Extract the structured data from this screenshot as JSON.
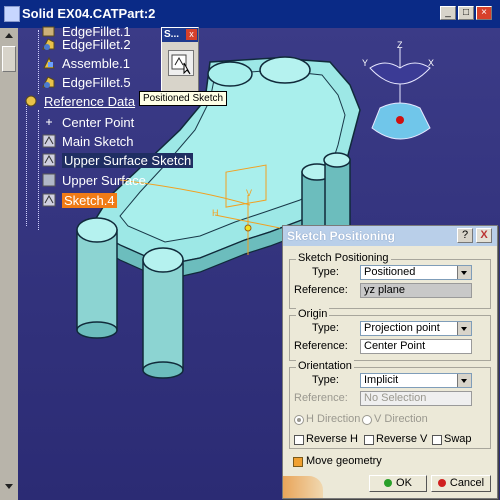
{
  "window": {
    "title": "Solid EX04.CATPart:2"
  },
  "tree": {
    "items": [
      {
        "label": "EdgeFillet.1",
        "icon": "edge-fillet-icon"
      },
      {
        "label": "EdgeFillet.2",
        "icon": "edge-fillet-icon"
      },
      {
        "label": "Assemble.1",
        "icon": "assemble-icon"
      },
      {
        "label": "EdgeFillet.5",
        "icon": "edge-fillet-icon"
      },
      {
        "label": "Reference Data",
        "icon": "reference-icon"
      },
      {
        "label": "Center Point",
        "icon": "point-icon"
      },
      {
        "label": "Main Sketch",
        "icon": "sketch-icon"
      },
      {
        "label": "Upper Surface Sketch",
        "icon": "sketch-icon"
      },
      {
        "label": "Upper Surface",
        "icon": "surface-icon"
      },
      {
        "label": "Sketch.4",
        "icon": "sketch-icon"
      }
    ]
  },
  "mini_toolbar": {
    "title": "S...",
    "close": "x"
  },
  "tooltip": "Positioned Sketch",
  "dialog": {
    "title": "Sketch Positioning",
    "help": "?",
    "close": "X",
    "sketch_positioning": {
      "group": "Sketch Positioning",
      "type_label": "Type:",
      "type_value": "Positioned",
      "reference_label": "Reference:",
      "reference_value": "yz plane"
    },
    "origin": {
      "group": "Origin",
      "type_label": "Type:",
      "type_value": "Projection point",
      "reference_label": "Reference:",
      "reference_value": "Center Point"
    },
    "orientation": {
      "group": "Orientation",
      "type_label": "Type:",
      "type_value": "Implicit",
      "reference_label": "Reference:",
      "reference_value": "No Selection",
      "h_direction": "H Direction",
      "v_direction": "V Direction",
      "reverse_h": "Reverse H",
      "reverse_v": "Reverse V",
      "swap": "Swap"
    },
    "move_geometry": "Move geometry",
    "ok": "OK",
    "cancel": "Cancel"
  },
  "compass": {
    "z": "Z",
    "y": "Y",
    "x": "X"
  },
  "axis": {
    "h": "H",
    "v": "V"
  }
}
